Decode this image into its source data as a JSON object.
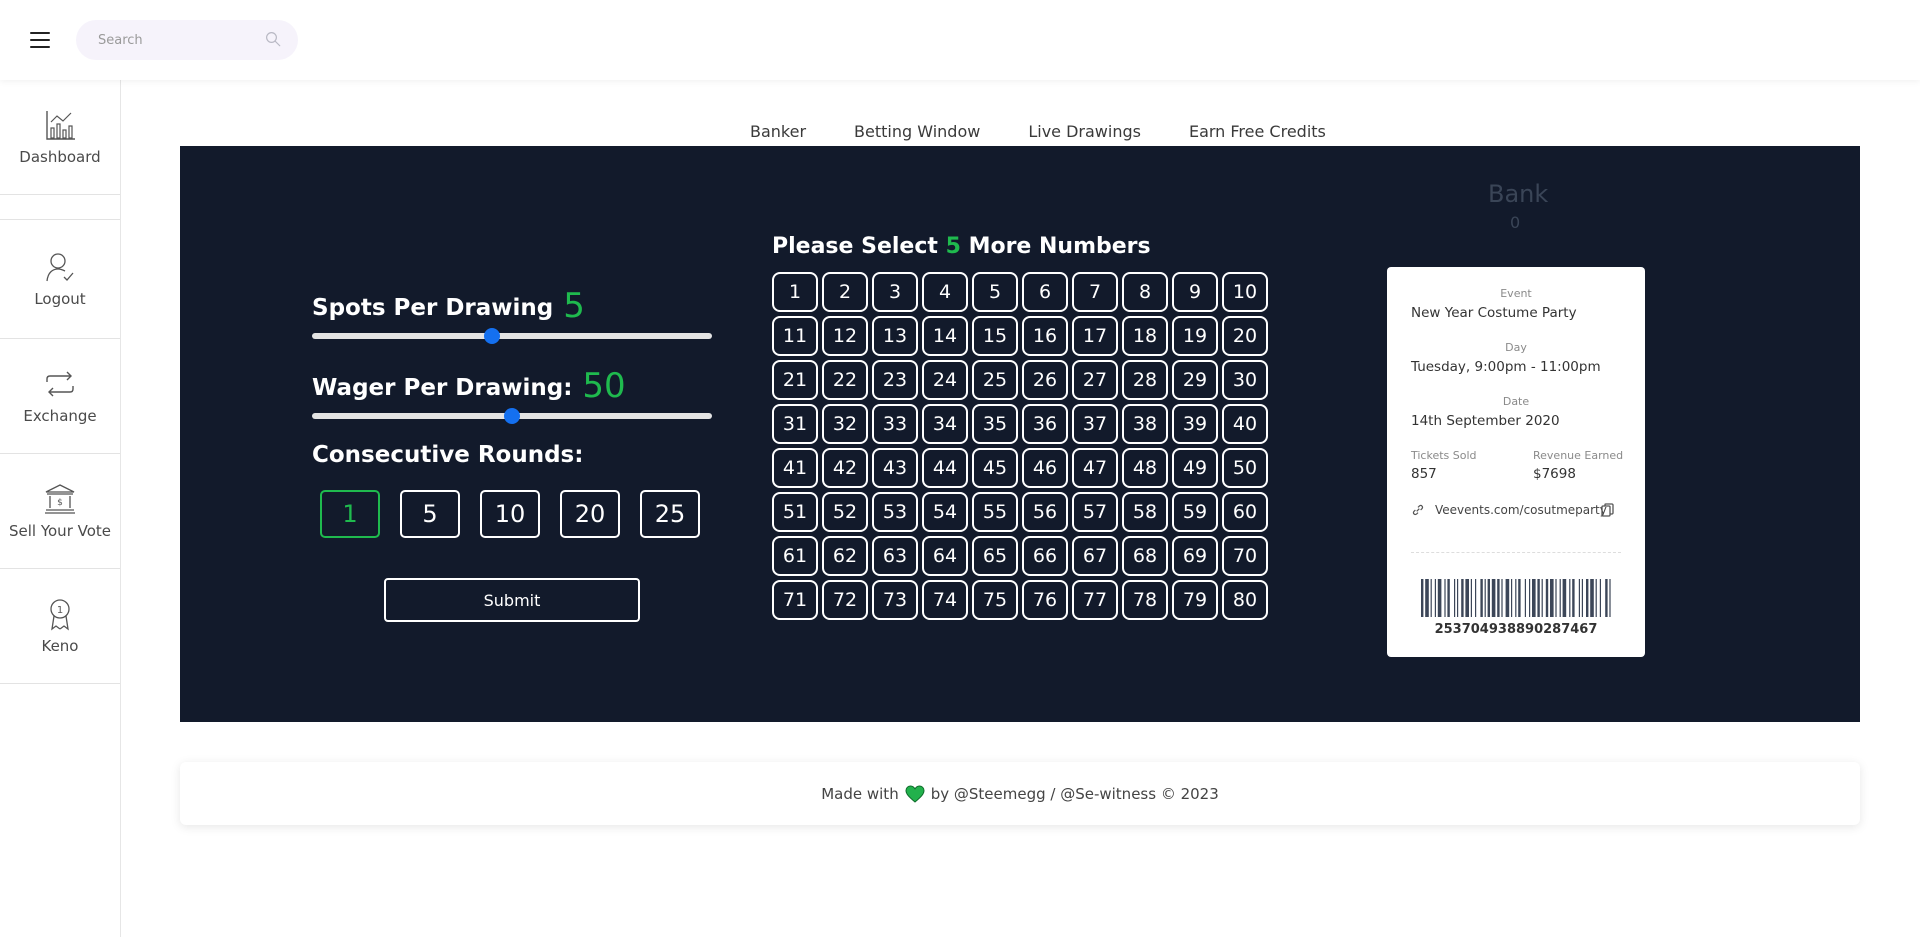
{
  "header": {
    "search": {
      "placeholder": "Search",
      "value": ""
    }
  },
  "sidebar": {
    "items": [
      {
        "label": "Dashboard",
        "icon": "chart-icon"
      },
      {
        "label": "Logout",
        "icon": "user-icon"
      },
      {
        "label": "Exchange",
        "icon": "exchange-icon"
      },
      {
        "label": "Sell Your Vote",
        "icon": "bank-icon"
      },
      {
        "label": "Keno",
        "icon": "medal-icon"
      }
    ]
  },
  "tabs": [
    {
      "label": "Banker",
      "active": true
    },
    {
      "label": "Betting Window",
      "active": false
    },
    {
      "label": "Live Drawings",
      "active": false
    },
    {
      "label": "Earn Free Credits",
      "active": false
    }
  ],
  "controls": {
    "spots_label": "Spots Per Drawing",
    "spots_value": "5",
    "spots_slider_fraction": 0.45,
    "wager_label": "Wager Per Drawing:",
    "wager_value": "50",
    "wager_slider_fraction": 0.5,
    "rounds_label": "Consecutive Rounds:",
    "rounds": [
      "1",
      "5",
      "10",
      "20",
      "25"
    ],
    "selected_round": "1",
    "submit_label": "Submit"
  },
  "number_select": {
    "title_prefix": "Please Select",
    "remaining": "5",
    "title_suffix": "More Numbers",
    "numbers": [
      "1",
      "2",
      "3",
      "4",
      "5",
      "6",
      "7",
      "8",
      "9",
      "10",
      "11",
      "12",
      "13",
      "14",
      "15",
      "16",
      "17",
      "18",
      "19",
      "20",
      "21",
      "22",
      "23",
      "24",
      "25",
      "26",
      "27",
      "28",
      "29",
      "30",
      "31",
      "32",
      "33",
      "34",
      "35",
      "36",
      "37",
      "38",
      "39",
      "40",
      "41",
      "42",
      "43",
      "44",
      "45",
      "46",
      "47",
      "48",
      "49",
      "50",
      "51",
      "52",
      "53",
      "54",
      "55",
      "56",
      "57",
      "58",
      "59",
      "60",
      "61",
      "62",
      "63",
      "64",
      "65",
      "66",
      "67",
      "68",
      "69",
      "70",
      "71",
      "72",
      "73",
      "74",
      "75",
      "76",
      "77",
      "78",
      "79",
      "80"
    ]
  },
  "bank": {
    "title": "Bank",
    "value": "0"
  },
  "ticket": {
    "event_caption": "Event",
    "event": "New Year Costume Party",
    "day_caption": "Day",
    "day": "Tuesday, 9:00pm - 11:00pm",
    "date_caption": "Date",
    "date": "14th September 2020",
    "tickets_caption": "Tickets Sold",
    "tickets": "857",
    "revenue_caption": "Revenue Earned",
    "revenue": "$7698",
    "link": "Veevents.com/cosutmeparty",
    "barcode_number": "253704938890287467"
  },
  "footer": {
    "made_with": "Made with",
    "by_text": "by @Steemegg / @Se-witness © 2023"
  },
  "colors": {
    "panel_bg": "#121a2b",
    "accent_green": "#1fba4e",
    "slider_thumb": "#1470f0",
    "tab_underline": "#2f6fdb"
  }
}
